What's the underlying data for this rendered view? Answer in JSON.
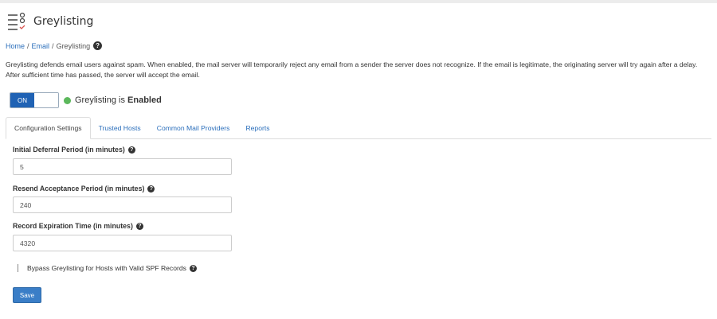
{
  "header": {
    "title": "Greylisting",
    "icon": "greylisting-settings-icon"
  },
  "breadcrumb": {
    "home": "Home",
    "email": "Email",
    "current": "Greylisting",
    "separator": "/"
  },
  "description": "Greylisting defends email users against spam. When enabled, the mail server will temporarily reject any email from a sender the server does not recognize. If the email is legitimate, the originating server will try again after a delay. After sufficient time has passed, the server will accept the email.",
  "toggle": {
    "label": "ON",
    "status_prefix": "Greylisting is",
    "status_value": "Enabled",
    "status_color": "#5cb85c",
    "accent": "#1f62b4"
  },
  "tabs": [
    {
      "label": "Configuration Settings",
      "active": true
    },
    {
      "label": "Trusted Hosts",
      "active": false
    },
    {
      "label": "Common Mail Providers",
      "active": false
    },
    {
      "label": "Reports",
      "active": false
    }
  ],
  "form": {
    "initial_deferral": {
      "label": "Initial Deferral Period (in minutes)",
      "value": "5"
    },
    "resend_acceptance": {
      "label": "Resend Acceptance Period (in minutes)",
      "value": "240"
    },
    "record_expiration": {
      "label": "Record Expiration Time (in minutes)",
      "value": "4320"
    },
    "bypass_checkbox": {
      "label": "Bypass Greylisting for Hosts with Valid SPF Records",
      "checked": false
    },
    "save_label": "Save"
  }
}
